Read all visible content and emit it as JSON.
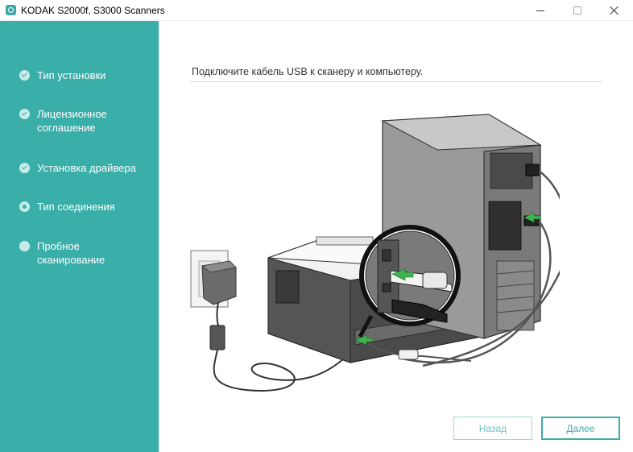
{
  "window": {
    "title": "KODAK S2000f, S3000 Scanners",
    "accent_color": "#3aafa9"
  },
  "sidebar": {
    "steps": [
      {
        "label": "Тип установки",
        "state": "done"
      },
      {
        "label": "Лицензионное соглашение",
        "state": "done"
      },
      {
        "label": "Установка драйвера",
        "state": "done"
      },
      {
        "label": "Тип соединения",
        "state": "current"
      },
      {
        "label": "Пробное сканирование",
        "state": "pending"
      }
    ]
  },
  "main": {
    "instruction": "Подключите кабель USB к сканеру и компьютеру.",
    "illustration_icon": "usb-connection-illustration"
  },
  "buttons": {
    "back_label": "Назад",
    "next_label": "Далее"
  }
}
